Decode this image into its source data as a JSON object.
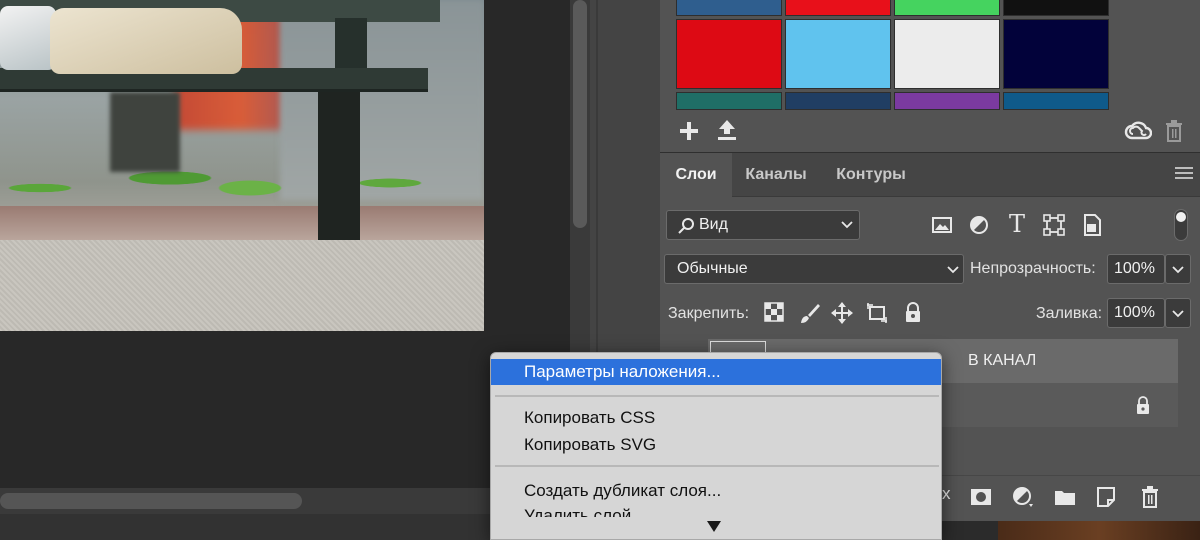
{
  "swatches": {
    "colors_row1": [
      "#2f5e8e",
      "#e8101a",
      "#45d35f",
      "#111111"
    ],
    "colors_row2": [
      "#dd0a14",
      "#60c3ee",
      "#ececec",
      "#02023a"
    ],
    "colors_row3": [
      "#1f6e66",
      "#203e63",
      "#7b3aa0",
      "#0f5a8a"
    ],
    "toolbar": {
      "add_icon": "plus-icon",
      "import_icon": "upload-icon",
      "cloud_icon": "creative-cloud-icon",
      "trash_icon": "trash-icon"
    }
  },
  "layers_panel": {
    "tabs": [
      {
        "label": "Слои",
        "active": true
      },
      {
        "label": "Каналы",
        "active": false
      },
      {
        "label": "Контуры",
        "active": false
      }
    ],
    "filter": {
      "label": "Вид"
    },
    "filter_icons": [
      "image-filter-icon",
      "adjustment-filter-icon",
      "type-filter-icon",
      "shape-filter-icon",
      "smart-object-filter-icon"
    ],
    "blend_mode": "Обычные",
    "opacity_label": "Непрозрачность:",
    "opacity_value": "100%",
    "lock_label": "Закрепить:",
    "lock_icons": [
      "lock-transparent-icon",
      "lock-pixels-icon",
      "lock-position-icon",
      "lock-artboard-icon",
      "lock-all-icon"
    ],
    "fill_label": "Заливка:",
    "fill_value": "100%",
    "layers": [
      {
        "name": "В КАНАЛ",
        "selected": true
      },
      {
        "name": "",
        "locked": true
      }
    ],
    "footer_icons": [
      "fx-icon",
      "mask-icon",
      "adjustment-icon",
      "folder-icon",
      "new-layer-icon",
      "trash-icon"
    ]
  },
  "context_menu": {
    "items": [
      {
        "label": "Параметры наложения...",
        "highlighted": true
      },
      {
        "label": "Копировать CSS"
      },
      {
        "label": "Копировать SVG"
      },
      {
        "label": "Создать дубликат слоя..."
      },
      {
        "label": "Удалить слой"
      }
    ],
    "scroll_arrow": "scroll-down-arrow-icon"
  }
}
